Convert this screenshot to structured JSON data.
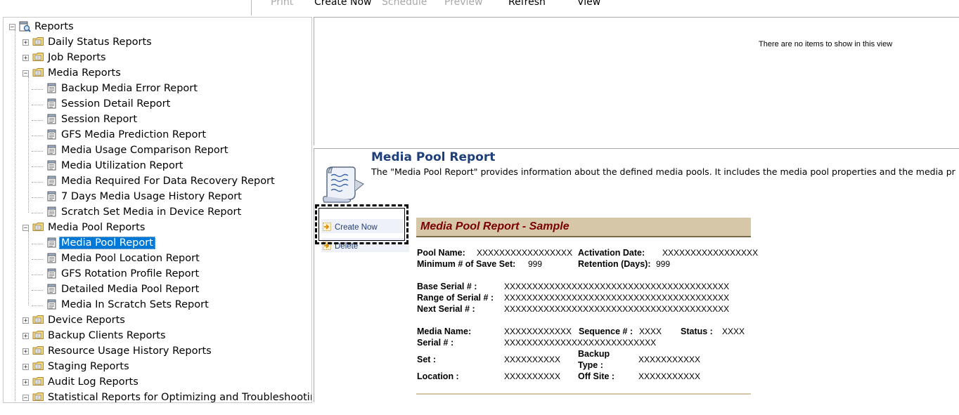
{
  "toolbar": {
    "print": "Print",
    "create_now": "Create Now",
    "schedule": "Schedule",
    "preview": "Preview",
    "refresh": "Refresh",
    "view": "View"
  },
  "tree": {
    "root": "Reports",
    "daily_status": "Daily Status Reports",
    "job": "Job Reports",
    "media": "Media Reports",
    "media_items": [
      "Backup Media Error Report",
      "Session Detail Report",
      "Session Report",
      "GFS Media Prediction Report",
      "Media Usage Comparison Report",
      "Media Utilization Report",
      "Media Required For Data Recovery Report",
      "7 Days Media Usage History Report",
      "Scratch Set Media in Device Report"
    ],
    "media_pool": "Media Pool Reports",
    "media_pool_items": [
      "Media Pool Report",
      "Media Pool Location Report",
      "GFS Rotation Profile Report",
      "Detailed Media Pool Report",
      "Media In Scratch Sets Report"
    ],
    "device": "Device Reports",
    "backup_clients": "Backup Clients Reports",
    "resource_usage": "Resource Usage History Reports",
    "staging": "Staging Reports",
    "audit_log": "Audit Log Reports",
    "statistical": "Statistical Reports for Optimizing and Troubleshooting"
  },
  "list": {
    "empty_message": "There are no items to show in this view"
  },
  "detail": {
    "title": "Media Pool Report",
    "description": "The \"Media Pool Report\" provides information about the defined media pools. It includes the media pool properties and the media pr",
    "actions": {
      "create_now": "Create Now",
      "delete": "Delete"
    }
  },
  "sample": {
    "header": "Media Pool Report - Sample",
    "pool_name_label": "Pool Name:",
    "pool_name_value": "XXXXXXXXXXXXXXXXX",
    "activation_date_label": "Activation Date:",
    "activation_date_value": "XXXXXXXXXXXXXXXXX",
    "min_save_set_label": "Minimum # of Save Set:",
    "min_save_set_value": "999",
    "retention_label": "Retention (Days):",
    "retention_value": "999",
    "base_serial_label": "Base Serial # :",
    "base_serial_value": "XXXXXXXXXXXXXXXXXXXXXXXXXXXXXXXXXXXXXXXX",
    "range_serial_label": "Range of Serial # :",
    "range_serial_value": "XXXXXXXXXXXXXXXXXXXXXXXXXXXXXXXXXXXXXXXX",
    "next_serial_label": "Next Serial # :",
    "next_serial_value": "XXXXXXXXXXXXXXXXXXXXXXXXXXXXXXXXXXXXXXXX",
    "media_name_label": "Media Name:",
    "media_name_value": "XXXXXXXXXXXX",
    "sequence_label": "Sequence # :",
    "sequence_value": "XXXX",
    "status_label": "Status :",
    "status_value": "XXXX",
    "serial_label": "Serial # :",
    "serial_value": "XXXXXXXXXXXXXXXXXXXXXXXXXXX",
    "set_label": "Set :",
    "set_value": "XXXXXXXXXX",
    "backup_type_label_1": "Backup",
    "backup_type_label_2": "Type :",
    "backup_type_value": "XXXXXXXXXXX",
    "location_label": "Location :",
    "location_value": "XXXXXXXXXX",
    "offsite_label": "Off Site :",
    "offsite_value": "XXXXXXXXXXX"
  }
}
